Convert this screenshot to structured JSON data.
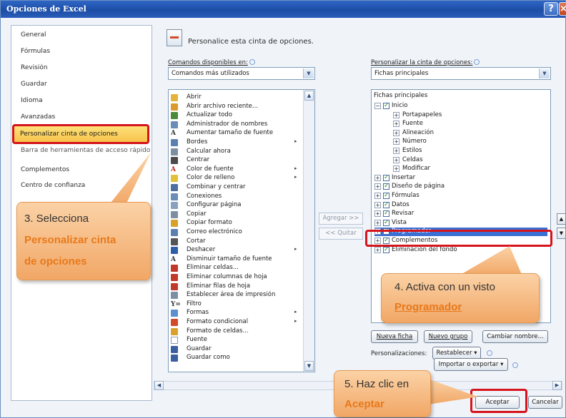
{
  "window": {
    "title": "Opciones de Excel",
    "help_icon": "help-icon",
    "close_icon": "close-icon"
  },
  "nav": {
    "items": [
      {
        "label": "General"
      },
      {
        "label": "Fórmulas"
      },
      {
        "label": "Revisión"
      },
      {
        "label": "Guardar"
      },
      {
        "label": "Idioma"
      },
      {
        "label": "Avanzadas"
      },
      {
        "label": "Personalizar cinta de opciones",
        "selected": true
      },
      {
        "label": "Barra de herramientas de acceso rápido"
      },
      {
        "label": "Complementos"
      },
      {
        "label": "Centro de confianza"
      }
    ]
  },
  "main": {
    "heading": "Personalice esta cinta de opciones.",
    "left_label": "Comandos disponibles en:",
    "left_combo_value": "Comandos más utilizados",
    "right_label": "Personalizar la cinta de opciones:",
    "right_combo_value": "Fichas principales",
    "add_button": "Agregar >>",
    "remove_button": "<< Quitar"
  },
  "commands": [
    {
      "label": "Abrir",
      "icon": "folder-open-icon",
      "color": "#e4b33a"
    },
    {
      "label": "Abrir archivo reciente...",
      "icon": "recent-file-icon",
      "color": "#d99b2b"
    },
    {
      "label": "Actualizar todo",
      "icon": "refresh-icon",
      "color": "#4c8b3a"
    },
    {
      "label": "Administrador de nombres",
      "icon": "name-manager-icon",
      "color": "#6a8db8"
    },
    {
      "label": "Aumentar tamaño de fuente",
      "icon": "font-grow-icon",
      "glyph": "A",
      "color": "#333"
    },
    {
      "label": "Bordes",
      "icon": "borders-icon",
      "color": "#5b7fb0",
      "submenu": true
    },
    {
      "label": "Calcular ahora",
      "icon": "calculator-icon",
      "color": "#7f8fa3"
    },
    {
      "label": "Centrar",
      "icon": "align-center-icon",
      "color": "#4a4a4a"
    },
    {
      "label": "Color de fuente",
      "icon": "font-color-icon",
      "glyph": "A",
      "color": "#c0271f",
      "submenu": true
    },
    {
      "label": "Color de relleno",
      "icon": "fill-color-icon",
      "color": "#e2c13a",
      "submenu": true
    },
    {
      "label": "Combinar y centrar",
      "icon": "merge-center-icon",
      "color": "#4a6fa0"
    },
    {
      "label": "Conexiones",
      "icon": "connections-icon",
      "color": "#6a8db8"
    },
    {
      "label": "Configurar página",
      "icon": "page-setup-icon",
      "color": "#8aa1bf"
    },
    {
      "label": "Copiar",
      "icon": "copy-icon",
      "color": "#7f8fa3"
    },
    {
      "label": "Copiar formato",
      "icon": "format-painter-icon",
      "color": "#d9a12b"
    },
    {
      "label": "Correo electrónico",
      "icon": "email-icon",
      "color": "#5b7fb0"
    },
    {
      "label": "Cortar",
      "icon": "cut-icon",
      "color": "#555"
    },
    {
      "label": "Deshacer",
      "icon": "undo-icon",
      "color": "#2f5ea8",
      "submenu": true
    },
    {
      "label": "Disminuir tamaño de fuente",
      "icon": "font-shrink-icon",
      "glyph": "A",
      "color": "#333"
    },
    {
      "label": "Eliminar celdas...",
      "icon": "delete-cells-icon",
      "color": "#c0392b"
    },
    {
      "label": "Eliminar columnas de hoja",
      "icon": "delete-columns-icon",
      "color": "#c0392b"
    },
    {
      "label": "Eliminar filas de hoja",
      "icon": "delete-rows-icon",
      "color": "#c0392b"
    },
    {
      "label": "Establecer área de impresión",
      "icon": "print-area-icon",
      "color": "#7f8fa3"
    },
    {
      "label": "Filtro",
      "icon": "filter-icon",
      "glyph": "Y=",
      "color": "#333"
    },
    {
      "label": "Formas",
      "icon": "shapes-icon",
      "color": "#5b8fd0",
      "submenu": true
    },
    {
      "label": "Formato condicional",
      "icon": "conditional-format-icon",
      "color": "#d24a2a",
      "submenu": true
    },
    {
      "label": "Formato de celdas...",
      "icon": "format-cells-icon",
      "color": "#d9a12b"
    },
    {
      "label": "Fuente",
      "icon": "font-icon",
      "color": "#ffffff",
      "font_box": true
    },
    {
      "label": "Guardar",
      "icon": "save-icon",
      "color": "#3a5fa0"
    },
    {
      "label": "Guardar como",
      "icon": "save-as-icon",
      "color": "#3a5fa0"
    }
  ],
  "tree": {
    "header": "Fichas principales",
    "rows": [
      {
        "indent": 0,
        "expander": "−",
        "checkbox": true,
        "checked": true,
        "label": "Inicio"
      },
      {
        "indent": 1,
        "expander": "+",
        "checkbox": false,
        "label": "Portapapeles"
      },
      {
        "indent": 1,
        "expander": "+",
        "checkbox": false,
        "label": "Fuente"
      },
      {
        "indent": 1,
        "expander": "+",
        "checkbox": false,
        "label": "Alineación"
      },
      {
        "indent": 1,
        "expander": "+",
        "checkbox": false,
        "label": "Número"
      },
      {
        "indent": 1,
        "expander": "+",
        "checkbox": false,
        "label": "Estilos"
      },
      {
        "indent": 1,
        "expander": "+",
        "checkbox": false,
        "label": "Celdas"
      },
      {
        "indent": 1,
        "expander": "+",
        "checkbox": false,
        "label": "Modificar"
      },
      {
        "indent": 0,
        "expander": "+",
        "checkbox": true,
        "checked": true,
        "label": "Insertar"
      },
      {
        "indent": 0,
        "expander": "+",
        "checkbox": true,
        "checked": true,
        "label": "Diseño de página"
      },
      {
        "indent": 0,
        "expander": "+",
        "checkbox": true,
        "checked": true,
        "label": "Fórmulas"
      },
      {
        "indent": 0,
        "expander": "+",
        "checkbox": true,
        "checked": true,
        "label": "Datos"
      },
      {
        "indent": 0,
        "expander": "+",
        "checkbox": true,
        "checked": true,
        "label": "Revisar"
      },
      {
        "indent": 0,
        "expander": "+",
        "checkbox": true,
        "checked": true,
        "label": "Vista"
      },
      {
        "indent": 0,
        "expander": "+",
        "checkbox": true,
        "checked": true,
        "label": "Programador",
        "selected": true
      },
      {
        "indent": 0,
        "expander": "+",
        "checkbox": true,
        "checked": true,
        "label": "Complementos"
      },
      {
        "indent": 0,
        "expander": "+",
        "checkbox": true,
        "checked": true,
        "label": "Eliminación del fondo"
      }
    ]
  },
  "buttons": {
    "new_tab": "Nueva ficha",
    "new_group": "Nuevo grupo",
    "rename": "Cambiar nombre...",
    "customizations_label": "Personalizaciones:",
    "reset": "Restablecer ▾",
    "import_export": "Importar o exportar ▾",
    "ok": "Aceptar",
    "cancel": "Cancelar"
  },
  "callouts": {
    "step3_text": "3. Selecciona",
    "step3_em1": "Personalizar cinta",
    "step3_em2": "de opciones",
    "step4_text": "4. Activa con un visto",
    "step4_em": "Programador",
    "step5_text": "5. Haz clic en",
    "step5_em": "Aceptar"
  },
  "colors": {
    "titlebar": "#1d4ea6",
    "selection": "#f8c24b",
    "highlight": "#d6141c",
    "callout_text": "#e8791b"
  }
}
